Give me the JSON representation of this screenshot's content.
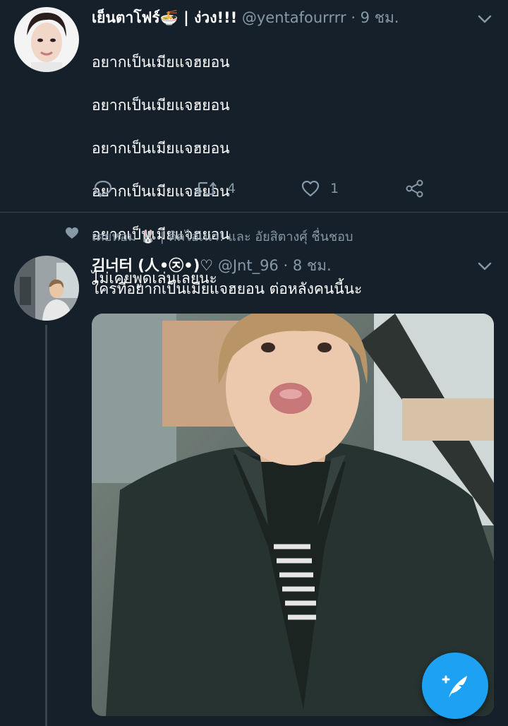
{
  "tweet1": {
    "display_name": "เย็นตาโฟร์",
    "name_suffix": " | ง่วง!!!",
    "handle": "@yentafourrrr",
    "time": "· 9 ชม.",
    "lines": [
      "อยากเป็นเมียแจฮยอน",
      "อยากเป็นเมียแจฮยอน",
      "อยากเป็นเมียแจฮยอน",
      "อยากเป็นเมียแจฮยอน",
      "อยากเป็นเมียแจฮยอน",
      "ไม่เคยพูดเล่นเลยนะ"
    ],
    "retweet_count": "4",
    "like_count": "1"
  },
  "tweet2": {
    "social_context": "เตยหอม 🐰 | ติดไอ่เน่า! และ อัยสิตางศุ์ ชื่นชอบ",
    "display_name": "김너터 (人•㉨•)♡",
    "handle": "@Jnt_96",
    "time": "· 8 ชม.",
    "text": "ใครที่อยากเป็นเมียแจฮยอน ต่อหลังคนนี้นะ"
  },
  "colors": {
    "background": "#15202b",
    "secondary_text": "#8899a6",
    "divider": "#38444d",
    "accent": "#1da1f2"
  },
  "icons": [
    "chevron-down-icon",
    "reply-icon",
    "retweet-icon",
    "like-icon",
    "share-icon",
    "heart-icon",
    "compose-tweet-icon"
  ]
}
